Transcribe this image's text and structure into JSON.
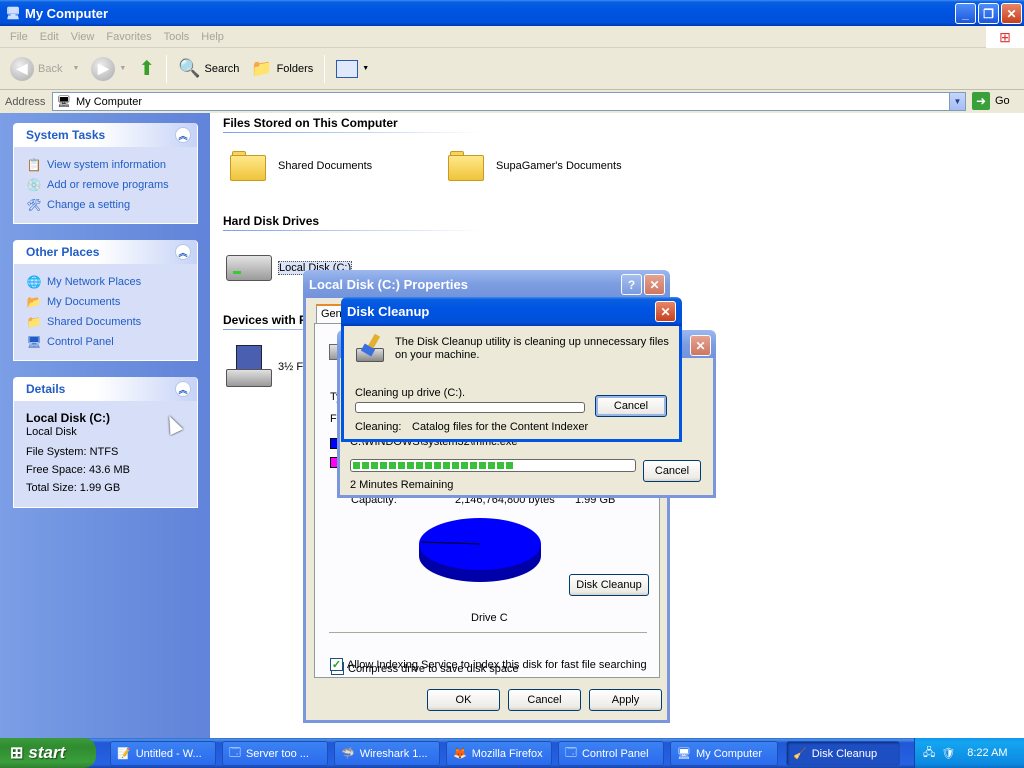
{
  "window": {
    "title": "My Computer"
  },
  "menu": [
    "File",
    "Edit",
    "View",
    "Favorites",
    "Tools",
    "Help"
  ],
  "toolbar": {
    "back": "Back",
    "search": "Search",
    "folders": "Folders"
  },
  "address": {
    "label": "Address",
    "value": "My Computer",
    "go": "Go"
  },
  "sidebar": {
    "system_tasks": {
      "title": "System Tasks",
      "items": [
        "View system information",
        "Add or remove programs",
        "Change a setting"
      ]
    },
    "other_places": {
      "title": "Other Places",
      "items": [
        "My Network Places",
        "My Documents",
        "Shared Documents",
        "Control Panel"
      ]
    },
    "details": {
      "title": "Details",
      "name": "Local Disk (C:)",
      "type": "Local Disk",
      "file_system": "File System: NTFS",
      "free_space": "Free Space: 43.6 MB",
      "total_size": "Total Size: 1.99 GB"
    }
  },
  "content": {
    "files_group": "Files Stored on This Computer",
    "shared_docs": "Shared Documents",
    "user_docs": "SupaGamer's Documents",
    "hdd_group": "Hard Disk Drives",
    "local_disk": "Local Disk (C:)",
    "devices_group": "Devices with R",
    "floppy": "3½ F"
  },
  "properties": {
    "title": "Local Disk (C:) Properties",
    "tab_general": "Gen",
    "type_label": "Ty",
    "fs_label": "Fi",
    "capacity_label": "Capacity:",
    "capacity_bytes": "2,146,764,800 bytes",
    "capacity_gb": "1.99 GB",
    "drive_label": "Drive C",
    "disk_cleanup_button": "Disk Cleanup",
    "compress_label": "Compress drive to save disk space",
    "indexing_label": "Allow Indexing Service to index this disk for fast file searching",
    "ok": "OK",
    "cancel": "Cancel",
    "apply": "Apply"
  },
  "scan_dialog": {
    "path": "C:\\WINDOWS\\system32\\mmc.exe",
    "progress": 0.57,
    "remaining": "2 Minutes Remaining",
    "cancel": "Cancel"
  },
  "cleanup_dialog": {
    "title": "Disk Cleanup",
    "message": "The Disk Cleanup utility is cleaning up unnecessary files on your machine.",
    "drive_label": "Cleaning up drive  (C:).",
    "progress": 0.0,
    "cleaning_label": "Cleaning:",
    "cleaning_value": "Catalog files for the Content Indexer",
    "cancel": "Cancel"
  },
  "taskbar": {
    "start": "start",
    "items": [
      "Untitled - W...",
      "Server too ...",
      "Wireshark 1...",
      "Mozilla Firefox",
      "Control Panel",
      "My Computer",
      "Disk Cleanup"
    ],
    "clock": "8:22 AM"
  },
  "colors": {
    "xp_blue": "#0054e3",
    "task_link": "#215dc6",
    "pie_used": "#0000ff",
    "pie_free": "#ff00ff",
    "progress_green": "#38c038"
  }
}
